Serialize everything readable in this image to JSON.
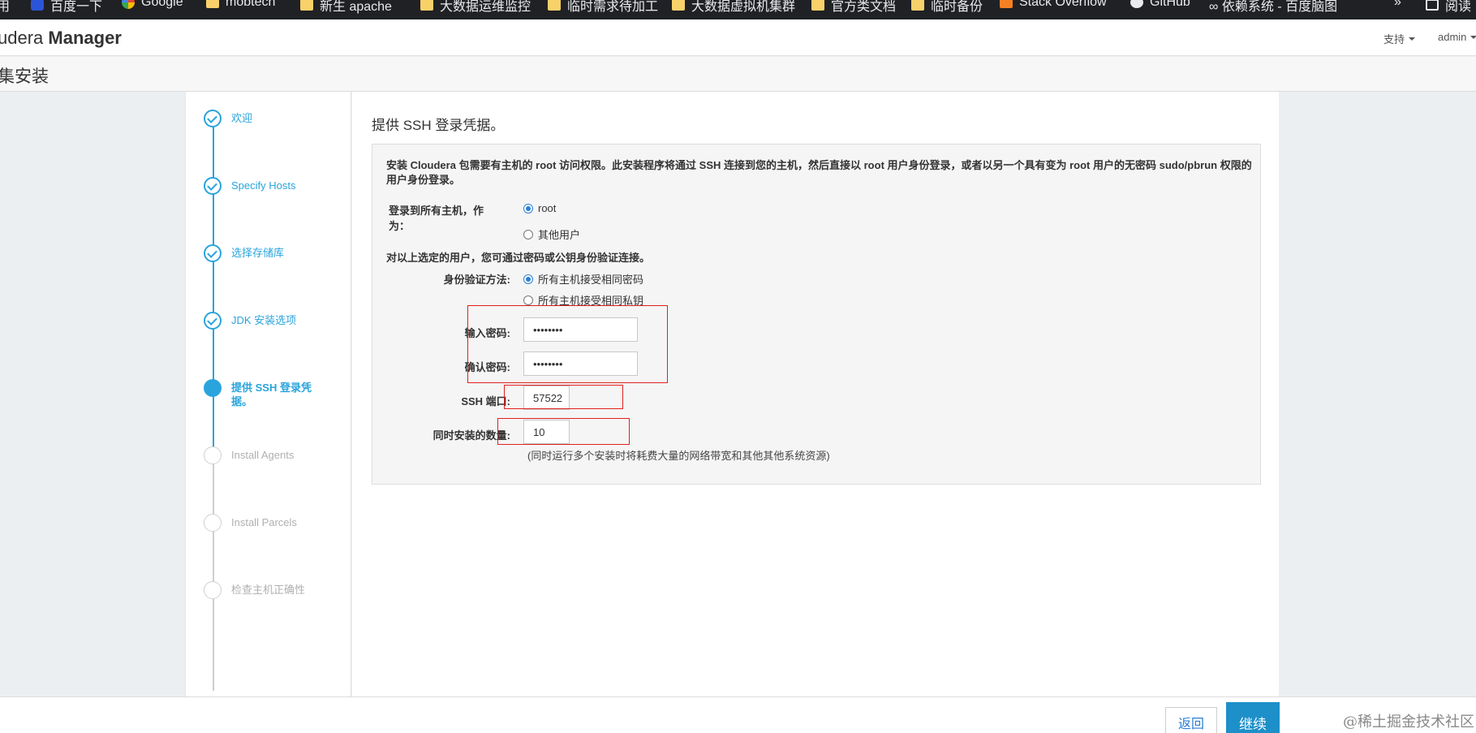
{
  "bookmarks": [
    {
      "label": "用",
      "icon": "none"
    },
    {
      "label": "百度一下",
      "icon": "baidu-icon"
    },
    {
      "label": "Google",
      "icon": "google-icon"
    },
    {
      "label": "mobtech",
      "icon": "folder-icon"
    },
    {
      "label": "新生 apache",
      "icon": "folder-icon"
    },
    {
      "label": "大数据运维监控",
      "icon": "folder-icon"
    },
    {
      "label": "临时需求待加工",
      "icon": "folder-icon"
    },
    {
      "label": "大数据虚拟机集群",
      "icon": "folder-icon"
    },
    {
      "label": "官方类文档",
      "icon": "folder-icon"
    },
    {
      "label": "临时备份",
      "icon": "folder-icon"
    },
    {
      "label": "Stack Overflow",
      "icon": "stackoverflow-icon"
    },
    {
      "label": "GitHub",
      "icon": "github-icon"
    },
    {
      "label": "∞ 依赖系统 - 百度脑图",
      "icon": "none"
    },
    {
      "label": "»",
      "icon": "none"
    },
    {
      "label": "阅读",
      "icon": "reading-list-icon"
    }
  ],
  "navbar": {
    "brand_light": "udera ",
    "brand_bold": "Manager",
    "support_label": "支持",
    "user_label": "admin"
  },
  "page_header": {
    "title": "集安装"
  },
  "wizard": {
    "steps": [
      {
        "label": "欢迎",
        "state": "done"
      },
      {
        "label": "Specify Hosts",
        "state": "done"
      },
      {
        "label": "选择存储库",
        "state": "done"
      },
      {
        "label": "JDK 安装选项",
        "state": "done"
      },
      {
        "label": "提供 SSH 登录凭据。",
        "state": "current"
      },
      {
        "label": "Install Agents",
        "state": "todo"
      },
      {
        "label": "Install Parcels",
        "state": "todo"
      },
      {
        "label": "检查主机正确性",
        "state": "todo"
      }
    ]
  },
  "main": {
    "title": "提供 SSH 登录凭据。",
    "intro": "安装 Cloudera 包需要有主机的 root 访问权限。此安装程序将通过 SSH 连接到您的主机，然后直接以 root 用户身份登录，或者以另一个具有变为 root 用户的无密码 sudo/pbrun 权限的用户身份登录。",
    "login_label": "登录到所有主机，作为：",
    "login_options": [
      {
        "label": "root",
        "selected": true
      },
      {
        "label": "其他用户",
        "selected": false
      }
    ],
    "auth_note": "对以上选定的用户，您可通过密码或公钥身份验证连接。",
    "auth_label": "身份验证方法:",
    "auth_options": [
      {
        "label": "所有主机接受相同密码",
        "selected": true
      },
      {
        "label": "所有主机接受相同私钥",
        "selected": false
      }
    ],
    "password_label": "输入密码:",
    "password_value": "••••••••",
    "confirm_label": "确认密码:",
    "confirm_value": "••••••••",
    "ssh_port_label": "SSH 端口:",
    "ssh_port_value": "57522",
    "concurrent_label": "同时安装的数量:",
    "concurrent_value": "10",
    "concurrent_hint": "(同时运行多个安装时将耗费大量的网络带宽和其他其他系统资源)"
  },
  "footer": {
    "back_label": "返回",
    "next_label": "继续",
    "watermark": "@稀土掘金技术社区"
  },
  "colors": {
    "accent": "#2aa4dc",
    "primary_button": "#1d8fc9",
    "highlight_box": "#e02020"
  }
}
